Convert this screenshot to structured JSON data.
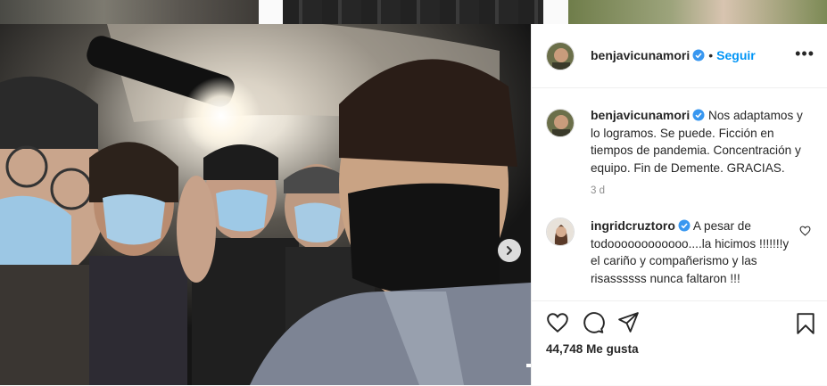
{
  "post": {
    "author": "benjavicunamori",
    "follow_label": "Seguir",
    "separator": "•",
    "more_label": "•••",
    "caption": "Nos adaptamos y lo logramos. Se puede. Ficción en tiempos de pandemia. Concentración y equipo. Fin de Demente. GRACIAS.",
    "time_ago": "3 d",
    "likes_count": "44,748",
    "likes_label": "Me gusta"
  },
  "comments": [
    {
      "author": "ingridcruztoro",
      "text": "A pesar de todoooooooooooo....la hicimos !!!!!!!y el cariño y compañerismo y las risassssss nunca faltaron !!!"
    }
  ],
  "icons": [
    "verified-badge-icon",
    "more-options-icon",
    "heart-icon",
    "comment-icon",
    "share-icon",
    "bookmark-icon",
    "chevron-right-icon"
  ],
  "colors": {
    "accent": "#0095f6",
    "text": "#262626",
    "muted": "#8e8e8e"
  }
}
